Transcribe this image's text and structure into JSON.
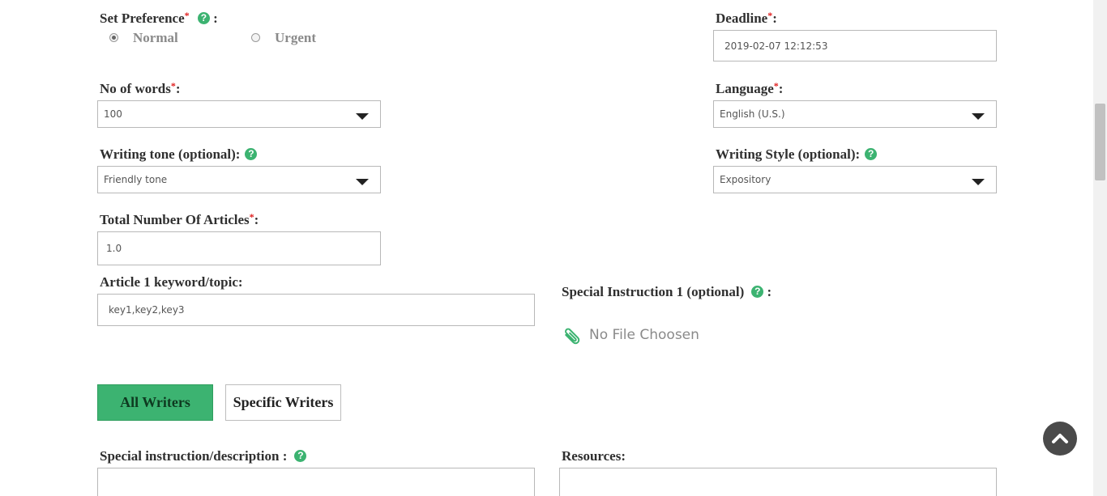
{
  "preference": {
    "label": "Set Preference",
    "required_mark": "*",
    "help_icon": "?",
    "colon": ":",
    "options": [
      {
        "label": "Normal",
        "checked": true
      },
      {
        "label": "Urgent",
        "checked": false
      }
    ]
  },
  "deadline": {
    "label": "Deadline",
    "required_mark": "*",
    "colon": ":",
    "value": "2019-02-07 12:12:53"
  },
  "words": {
    "label": "No of words",
    "required_mark": "*",
    "colon": ":",
    "value": "100"
  },
  "language": {
    "label": "Language",
    "required_mark": "*",
    "colon": ":",
    "value": "English (U.S.)"
  },
  "tone": {
    "label": "Writing tone (optional):",
    "help_icon": "?",
    "value": "Friendly tone"
  },
  "style": {
    "label": "Writing Style (optional):",
    "help_icon": "?",
    "value": "Expository"
  },
  "articles": {
    "label": "Total Number Of Articles",
    "required_mark": "*",
    "colon": ":",
    "value": "1.0"
  },
  "keyword": {
    "label": "Article 1 keyword/topic:",
    "value": "key1,key2,key3"
  },
  "special_instruction_file": {
    "label": "Special Instruction 1 (optional)",
    "help_icon": "?",
    "colon": ":",
    "file_text": "No File Choosen"
  },
  "writers": {
    "all_label": "All Writers",
    "specific_label": "Specific Writers"
  },
  "description": {
    "label": "Special instruction/description :",
    "help_icon": "?"
  },
  "resources": {
    "label": "Resources:"
  },
  "colors": {
    "accent": "#3cb371",
    "required": "#e02020",
    "scroll_button": "#4a4a4a"
  },
  "icons": {
    "attach": "paperclip-icon",
    "scroll_top": "chevron-up-icon",
    "help": "question-icon"
  }
}
